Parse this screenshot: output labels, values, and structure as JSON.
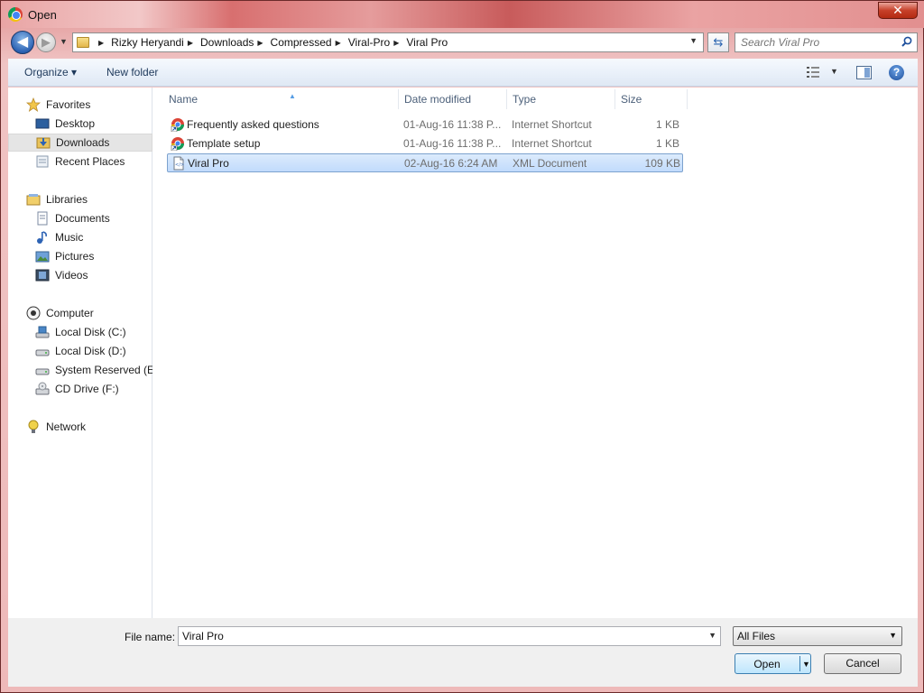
{
  "window": {
    "title": "Open",
    "close_label": "✕"
  },
  "nav": {
    "back_glyph": "◀",
    "forward_glyph": "▶",
    "breadcrumbs": [
      "Rizky Heryandi",
      "Downloads",
      "Compressed",
      "Viral-Pro",
      "Viral Pro"
    ],
    "search_placeholder": "Search Viral Pro"
  },
  "toolbar": {
    "organize": "Organize ▾",
    "new_folder": "New folder",
    "help": "?"
  },
  "sidebar": {
    "favorites": {
      "label": "Favorites",
      "items": [
        "Desktop",
        "Downloads",
        "Recent Places"
      ]
    },
    "libraries": {
      "label": "Libraries",
      "items": [
        "Documents",
        "Music",
        "Pictures",
        "Videos"
      ]
    },
    "computer": {
      "label": "Computer",
      "items": [
        "Local Disk (C:)",
        "Local Disk (D:)",
        "System Reserved (E:)",
        "CD Drive (F:)"
      ]
    },
    "network": {
      "label": "Network"
    },
    "selected": "Downloads"
  },
  "files": {
    "columns": [
      "Name",
      "Date modified",
      "Type",
      "Size"
    ],
    "rows": [
      {
        "name": "Frequently asked questions",
        "date": "01-Aug-16 11:38 P...",
        "type": "Internet Shortcut",
        "size": "1 KB",
        "icon": "chrome-shortcut-icon"
      },
      {
        "name": "Template setup",
        "date": "01-Aug-16 11:38 P...",
        "type": "Internet Shortcut",
        "size": "1 KB",
        "icon": "chrome-shortcut-icon"
      },
      {
        "name": "Viral Pro",
        "date": "02-Aug-16 6:24 AM",
        "type": "XML Document",
        "size": "109 KB",
        "icon": "xml-document-icon"
      }
    ],
    "selected_index": 2
  },
  "footer": {
    "file_name_label": "File name:",
    "file_name_value": "Viral Pro",
    "filter_value": "All Files",
    "open_label": "Open",
    "cancel_label": "Cancel"
  },
  "colors": {
    "frame": "#e7a8a8",
    "selection": "#c1dbfc",
    "toolbar": "#eaf1fa"
  }
}
